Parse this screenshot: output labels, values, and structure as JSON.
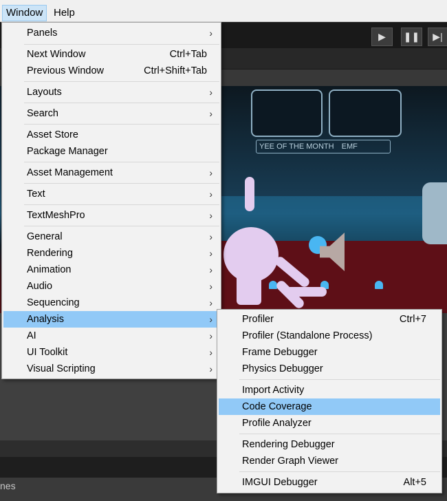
{
  "menubar": {
    "items": [
      {
        "label": "Window",
        "active": true
      },
      {
        "label": "Help",
        "active": false
      }
    ]
  },
  "toolbar": {
    "play_icon": "play-icon",
    "pause_icon": "pause-icon",
    "step_icon": "step-icon"
  },
  "window_menu": {
    "items": [
      {
        "label": "Panels",
        "shortcut": "",
        "submenu": true
      },
      {
        "label": "Next Window",
        "shortcut": "Ctrl+Tab",
        "submenu": false
      },
      {
        "label": "Previous Window",
        "shortcut": "Ctrl+Shift+Tab",
        "submenu": false
      },
      {
        "label": "Layouts",
        "shortcut": "",
        "submenu": true
      },
      {
        "label": "Search",
        "shortcut": "",
        "submenu": true
      },
      {
        "label": "Asset Store",
        "shortcut": "",
        "submenu": false
      },
      {
        "label": "Package Manager",
        "shortcut": "",
        "submenu": false
      },
      {
        "label": "Asset Management",
        "shortcut": "",
        "submenu": true
      },
      {
        "label": "Text",
        "shortcut": "",
        "submenu": true
      },
      {
        "label": "TextMeshPro",
        "shortcut": "",
        "submenu": true
      },
      {
        "label": "General",
        "shortcut": "",
        "submenu": true
      },
      {
        "label": "Rendering",
        "shortcut": "",
        "submenu": true
      },
      {
        "label": "Animation",
        "shortcut": "",
        "submenu": true
      },
      {
        "label": "Audio",
        "shortcut": "",
        "submenu": true
      },
      {
        "label": "Sequencing",
        "shortcut": "",
        "submenu": true
      },
      {
        "label": "Analysis",
        "shortcut": "",
        "submenu": true
      },
      {
        "label": "AI",
        "shortcut": "",
        "submenu": true
      },
      {
        "label": "UI Toolkit",
        "shortcut": "",
        "submenu": true
      },
      {
        "label": "Visual Scripting",
        "shortcut": "",
        "submenu": true
      }
    ],
    "highlighted": "Analysis"
  },
  "analysis_menu": {
    "items": [
      {
        "label": "Profiler",
        "shortcut": "Ctrl+7"
      },
      {
        "label": "Profiler (Standalone Process)",
        "shortcut": ""
      },
      {
        "label": "Frame Debugger",
        "shortcut": ""
      },
      {
        "label": "Physics Debugger",
        "shortcut": ""
      },
      {
        "label": "Import Activity",
        "shortcut": ""
      },
      {
        "label": "Code Coverage",
        "shortcut": ""
      },
      {
        "label": "Profile Analyzer",
        "shortcut": ""
      },
      {
        "label": "Rendering Debugger",
        "shortcut": ""
      },
      {
        "label": "Render Graph Viewer",
        "shortcut": ""
      },
      {
        "label": "IMGUI Debugger",
        "shortcut": "Alt+5"
      }
    ],
    "highlighted": "Code Coverage"
  },
  "scene": {
    "wall_text": "YEE OF THE MONTH",
    "wall_text2": "EMF",
    "bottom_label": "nes"
  },
  "colors": {
    "highlight": "#91c9f7",
    "menu_bg": "#f2f2f2",
    "gizmo": "#e3ccef",
    "light_icon": "#49b6f2"
  }
}
